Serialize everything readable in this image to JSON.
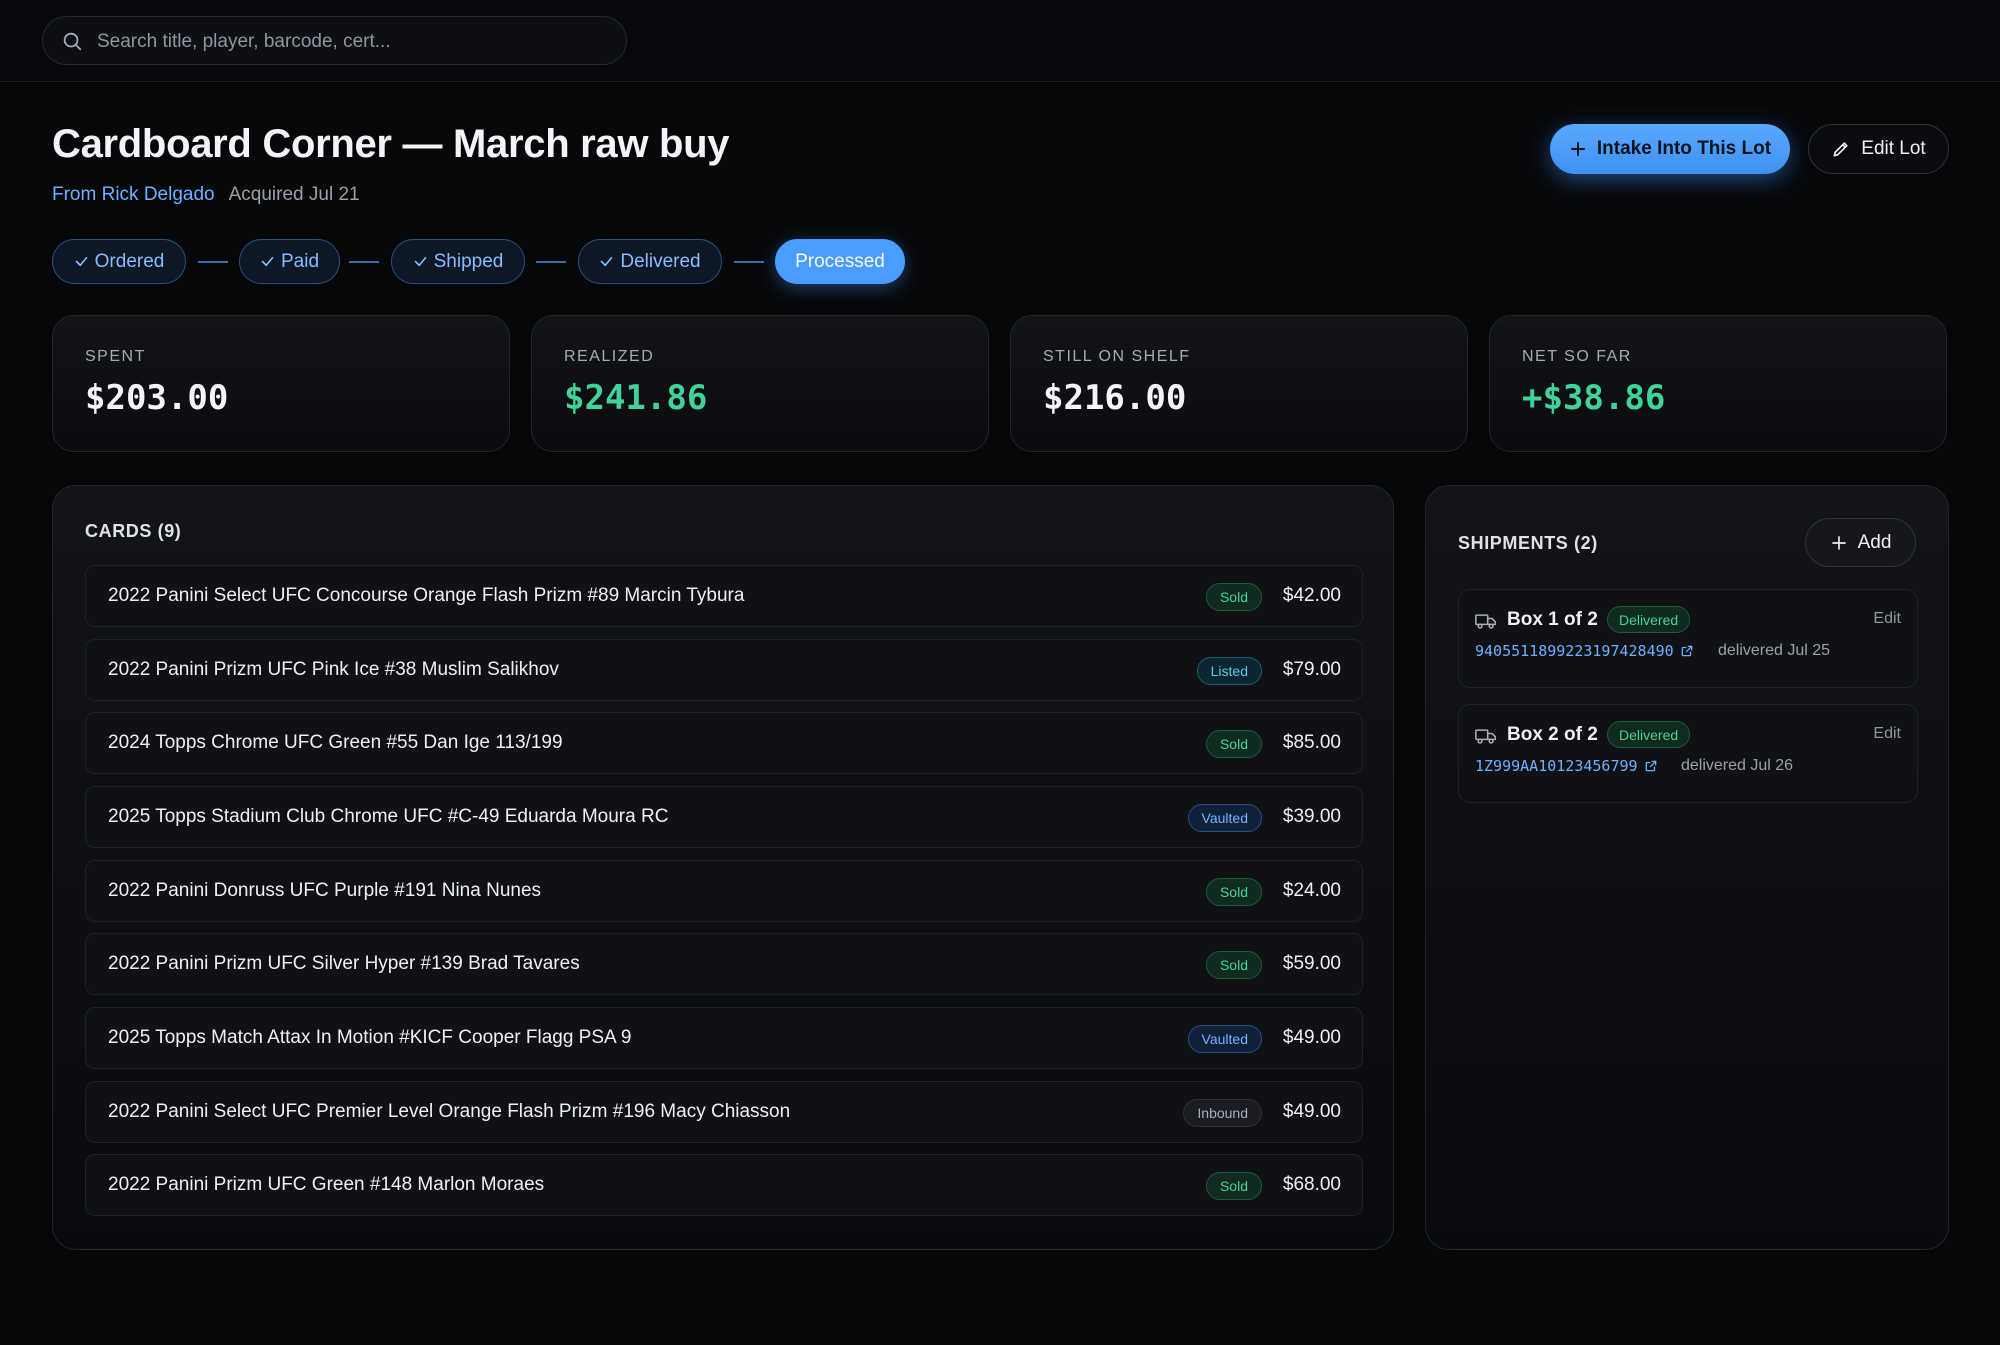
{
  "search": {
    "placeholder": "Search title, player, barcode, cert..."
  },
  "header": {
    "title": "Cardboard Corner — March raw buy",
    "from_label": "From Rick Delgado",
    "acquired_label": "Acquired Jul 21",
    "intake_button": "Intake Into This Lot",
    "edit_button": "Edit Lot"
  },
  "steps": [
    {
      "label": "Ordered",
      "done": true
    },
    {
      "label": "Paid",
      "done": true
    },
    {
      "label": "Shipped",
      "done": true
    },
    {
      "label": "Delivered",
      "done": true
    },
    {
      "label": "Processed",
      "active": true
    }
  ],
  "stats": [
    {
      "label": "SPENT",
      "value": "$203.00"
    },
    {
      "label": "REALIZED",
      "value": "$241.86"
    },
    {
      "label": "STILL ON SHELF",
      "value": "$216.00"
    },
    {
      "label": "NET SO FAR",
      "value": "+$38.86"
    }
  ],
  "cards": {
    "heading": "CARDS (9)",
    "rows": [
      {
        "name": "2022 Panini Select UFC Concourse Orange Flash Prizm #89 Marcin Tybura",
        "status": "Sold",
        "price": "$42.00"
      },
      {
        "name": "2022 Panini Prizm UFC Pink Ice #38 Muslim Salikhov",
        "status": "Listed",
        "price": "$79.00"
      },
      {
        "name": "2024 Topps Chrome UFC Green #55 Dan Ige 113/199",
        "status": "Sold",
        "price": "$85.00"
      },
      {
        "name": "2025 Topps Stadium Club Chrome UFC #C-49 Eduarda Moura RC",
        "status": "Vaulted",
        "price": "$39.00"
      },
      {
        "name": "2022 Panini Donruss UFC Purple #191 Nina Nunes",
        "status": "Sold",
        "price": "$24.00"
      },
      {
        "name": "2022 Panini Prizm UFC Silver Hyper #139 Brad Tavares",
        "status": "Sold",
        "price": "$59.00"
      },
      {
        "name": "2025 Topps Match Attax In Motion #KICF Cooper Flagg PSA 9",
        "status": "Vaulted",
        "price": "$49.00"
      },
      {
        "name": "2022 Panini Select UFC Premier Level Orange Flash Prizm #196 Macy Chiasson",
        "status": "Inbound",
        "price": "$49.00"
      },
      {
        "name": "2022 Panini Prizm UFC Green #148 Marlon Moraes",
        "status": "Sold",
        "price": "$68.00"
      }
    ]
  },
  "shipments": {
    "heading": "SHIPMENTS (2)",
    "add_button": "Add",
    "rows": [
      {
        "box": "Box 1 of 2",
        "status": "Delivered",
        "edit": "Edit",
        "tracking": "9405511899223197428490",
        "delivered": "delivered Jul 25"
      },
      {
        "box": "Box 2 of 2",
        "status": "Delivered",
        "edit": "Edit",
        "tracking": "1Z999AA10123456799",
        "delivered": "delivered Jul 26"
      }
    ]
  },
  "colors": {
    "accent": "#4b9cff",
    "positive": "#3fd39a",
    "background": "#060709"
  }
}
